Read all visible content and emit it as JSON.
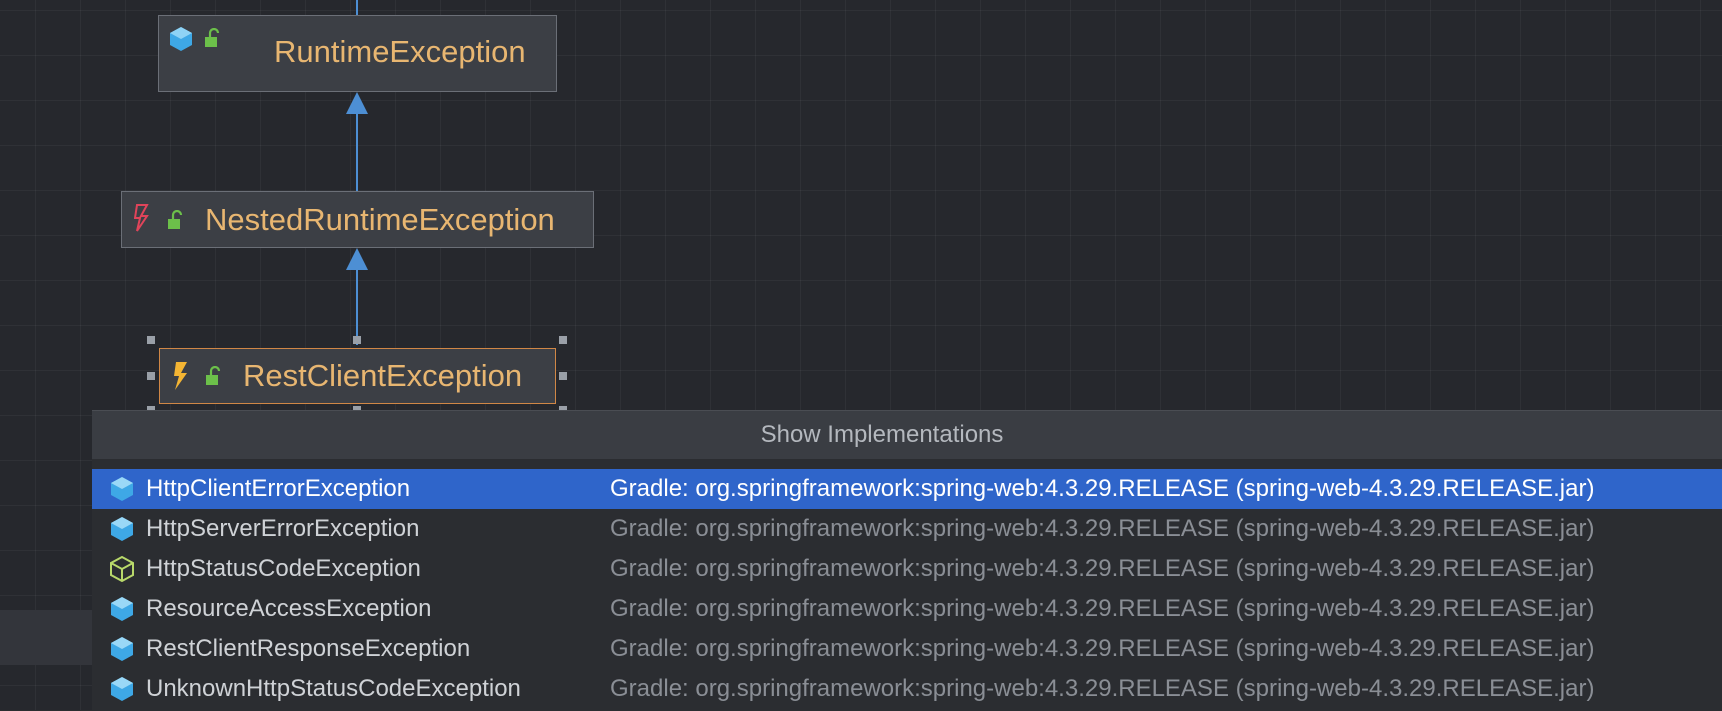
{
  "diagram": {
    "nodes": [
      {
        "label": "RuntimeException",
        "icons": [
          "class-icon",
          "unlock-icon"
        ]
      },
      {
        "label": "NestedRuntimeException",
        "icons": [
          "abstract-class-icon",
          "unlock-icon"
        ]
      },
      {
        "label": "RestClientException",
        "icons": [
          "exception-class-icon",
          "unlock-icon"
        ],
        "selected": true
      }
    ],
    "colors": {
      "node_text": "#e8b671",
      "edge": "#4d8fd4",
      "selection_border": "#d08746"
    }
  },
  "popup": {
    "title": "Show Implementations",
    "rows": [
      {
        "name": "HttpClientErrorException",
        "location": "Gradle: org.springframework:spring-web:4.3.29.RELEASE (spring-web-4.3.29.RELEASE.jar)",
        "icon": "class-icon",
        "selected": true
      },
      {
        "name": "HttpServerErrorException",
        "location": "Gradle: org.springframework:spring-web:4.3.29.RELEASE (spring-web-4.3.29.RELEASE.jar)",
        "icon": "class-icon"
      },
      {
        "name": "HttpStatusCodeException",
        "location": "Gradle: org.springframework:spring-web:4.3.29.RELEASE (spring-web-4.3.29.RELEASE.jar)",
        "icon": "abstract-class-icon"
      },
      {
        "name": "ResourceAccessException",
        "location": "Gradle: org.springframework:spring-web:4.3.29.RELEASE (spring-web-4.3.29.RELEASE.jar)",
        "icon": "class-icon"
      },
      {
        "name": "RestClientResponseException",
        "location": "Gradle: org.springframework:spring-web:4.3.29.RELEASE (spring-web-4.3.29.RELEASE.jar)",
        "icon": "class-icon"
      },
      {
        "name": "UnknownHttpStatusCodeException",
        "location": "Gradle: org.springframework:spring-web:4.3.29.RELEASE (spring-web-4.3.29.RELEASE.jar)",
        "icon": "class-icon"
      }
    ],
    "colors": {
      "selected_row": "#2f65ca",
      "class_icon": "#3ea8e6",
      "abstract_icon": "#b8d86a"
    }
  }
}
